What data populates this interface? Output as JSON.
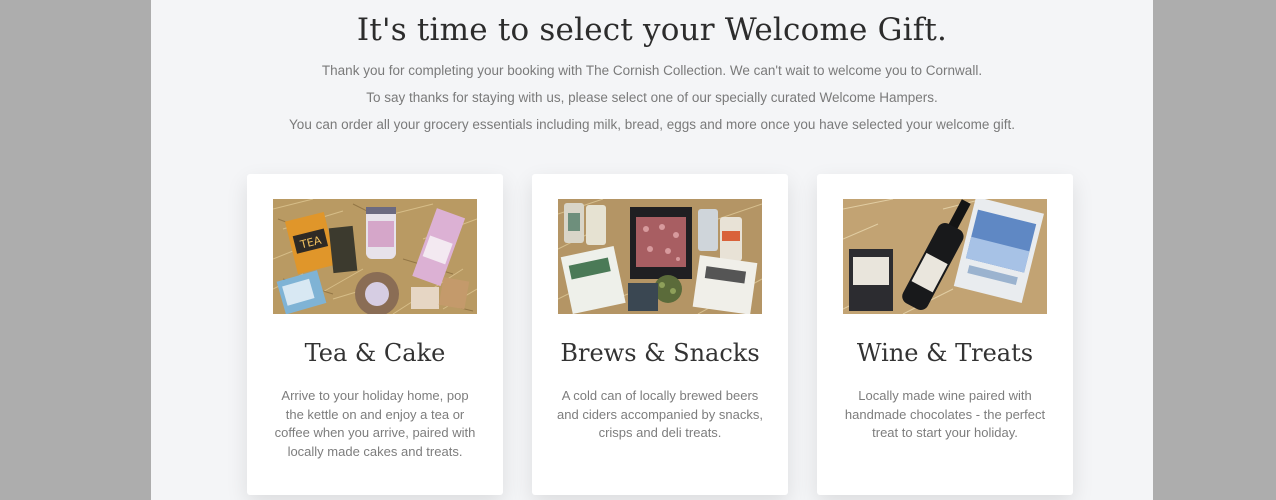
{
  "header": {
    "title": "It's time to select your Welcome Gift.",
    "line1": "Thank you for completing your booking with The Cornish Collection. We can't wait to welcome you to Cornwall.",
    "line2": "To say thanks for staying with us, please select one of our specially curated Welcome Hampers.",
    "line3": "You can order all your grocery essentials including milk, bread, eggs and more once you have selected your welcome gift."
  },
  "hampers": [
    {
      "title": "Tea & Cake",
      "description": "Arrive to your holiday home, pop the kettle on and enjoy a tea or coffee when you arrive, paired with locally made cakes and treats.",
      "tea_box_label": "TEA"
    },
    {
      "title": "Brews & Snacks",
      "description": "A cold can of locally brewed beers and ciders accompanied by snacks, crisps and deli treats."
    },
    {
      "title": "Wine & Treats",
      "description": "Locally made wine paired with handmade chocolates - the perfect treat to start your holiday."
    }
  ],
  "colors": {
    "page_background": "#adadad",
    "panel_background": "#f4f5f7",
    "card_background": "#ffffff",
    "straw": "#b99a63"
  }
}
